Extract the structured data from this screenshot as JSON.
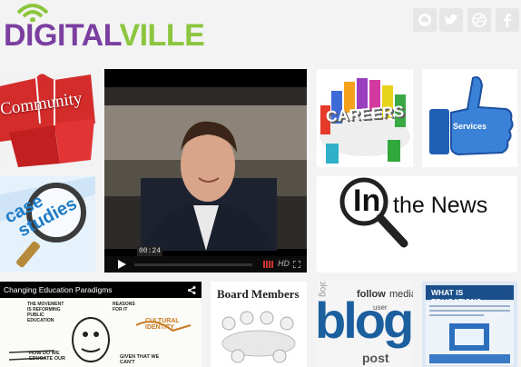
{
  "brand": {
    "part1": "DIGITAL",
    "part2": "VILLE",
    "color1": "#7b3fa0",
    "color2": "#8cc63f"
  },
  "social": [
    {
      "name": "github-icon"
    },
    {
      "name": "twitter-icon"
    },
    {
      "name": "dribbble-icon"
    },
    {
      "name": "facebook-icon"
    }
  ],
  "tiles": {
    "community": {
      "label": "Community",
      "accent": "#d42b2b"
    },
    "video": {
      "time": "00:24",
      "hd": "HD"
    },
    "careers": {
      "label": "CAREERS"
    },
    "services": {
      "label": "Services",
      "accent": "#2f74c9"
    },
    "case_studies": {
      "label1": "case",
      "label2": "studies"
    },
    "news": {
      "big": "In",
      "rest": "the News"
    },
    "paradigms": {
      "title": "Changing Education Paradigms",
      "t1": "THE MOVEMENT IS REFORMING PUBLIC EDUCATION",
      "t2": "REASONS FOR IT",
      "t3": "CULTURAL IDENTITY",
      "t4": "HOW DO WE EDUCATE OUR",
      "t5": "GIVEN THAT WE CAN'T"
    },
    "board": {
      "title": "Board Members"
    },
    "blog": {
      "big": "blog",
      "w1": "follow",
      "w2": "media",
      "w3": "post",
      "w4": "user",
      "w5": "blog"
    },
    "education": {
      "title": "WHAT IS EDUCATION?"
    }
  }
}
